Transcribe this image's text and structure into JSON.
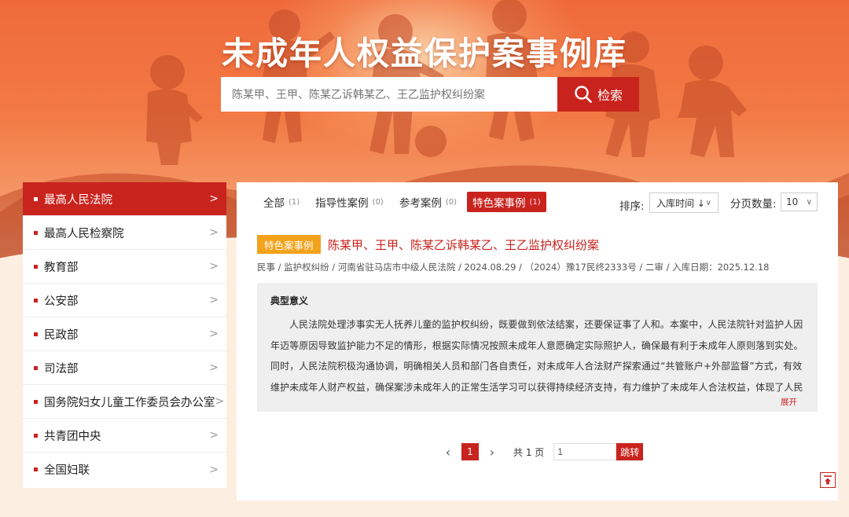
{
  "header": {
    "title": "未成年人权益保护案事例库",
    "search_placeholder": "陈某甲、王甲、陈某乙诉韩某乙、王乙监护权纠纷案",
    "search_button": "检索",
    "colors": {
      "brand_red": "#c9231e",
      "hero_orange": "#ef6a3b"
    }
  },
  "sidebar": {
    "items": [
      {
        "label": "最高人民法院",
        "active": true
      },
      {
        "label": "最高人民检察院"
      },
      {
        "label": "教育部"
      },
      {
        "label": "公安部"
      },
      {
        "label": "民政部"
      },
      {
        "label": "司法部"
      },
      {
        "label": "国务院妇女儿童工作委员会办公室"
      },
      {
        "label": "共青团中央"
      },
      {
        "label": "全国妇联"
      }
    ],
    "chevron": ">"
  },
  "tabs": [
    {
      "label": "全部",
      "count": "(1)"
    },
    {
      "label": "指导性案例",
      "count": "(0)"
    },
    {
      "label": "参考案例",
      "count": "(0)"
    },
    {
      "label": "特色案事例",
      "count": "(1)",
      "active": true
    }
  ],
  "sort": {
    "label": "排序:",
    "value": "入库时间 ↓"
  },
  "page_size": {
    "label": "分页数量:",
    "value": "10"
  },
  "case": {
    "tag": "特色案事例",
    "title": "陈某甲、王甲、陈某乙诉韩某乙、王乙监护权纠纷案",
    "meta": "民事 / 监护权纠纷 / 河南省驻马店市中级人民法院 / 2024.08.29 / （2024）豫17民终2333号 / 二审 / 入库日期：2025.12.18",
    "summary_title": "典型意义",
    "summary_body": "人民法院处理涉事实无人抚养儿童的监护权纠纷，既要做到依法结案，还要保证事了人和。本案中，人民法院针对监护人因年迈等原因导致监护能力不足的情形，根据实际情况按照未成年人意愿确定实际照护人，确保最有利于未成年人原则落到实处。同时，人民法院积极沟通协调，明确相关人员和部门各自责任，对未成年人合法财产探索通过“共管账户+外部监督”方式，有效维护未成年人财产权益，确保案涉未成年人的正常生活学习可以获得持续经济支持，有力维护了未成年人合法权益，体现了人民",
    "expand": "展开"
  },
  "pagination": {
    "prev": "‹",
    "current": "1",
    "next": "›",
    "total": "共 1 页",
    "jump_value": "1",
    "jump_button": "跳转"
  },
  "icons": {
    "search": "search-icon",
    "back_to_top": "back-to-top-icon"
  }
}
